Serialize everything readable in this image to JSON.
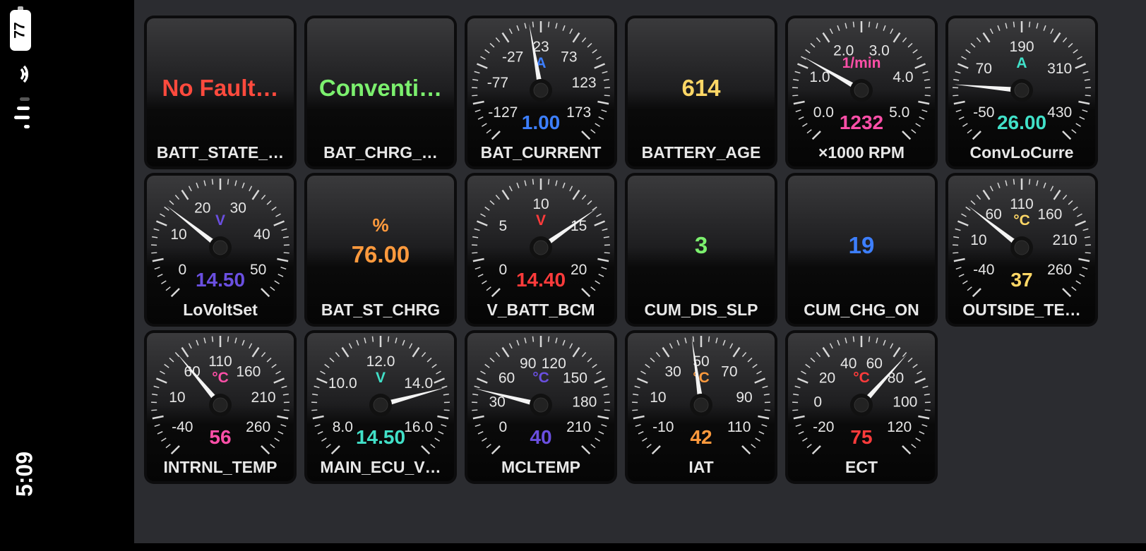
{
  "status_bar": {
    "time": "5:09",
    "battery": "77",
    "wifi_icon": "wifi-icon",
    "signal_icon": "cellular-signal-icon"
  },
  "tiles": [
    {
      "kind": "text",
      "value": "No Fault…",
      "label": "BATT_STATE_…",
      "color": "#ff4a3d"
    },
    {
      "kind": "text",
      "value": "Conventi…",
      "label": "BAT_CHRG_…",
      "color": "#7cf06e"
    },
    {
      "kind": "gauge",
      "unit": "A",
      "value": "1.00",
      "label": "BAT_CURRENT",
      "ticks": [
        "-127",
        "-77",
        "-27",
        "23",
        "73",
        "123",
        "173"
      ],
      "needle": -10,
      "color": "#3d7fff"
    },
    {
      "kind": "text",
      "value": "614",
      "label": "BATTERY_AGE",
      "color": "#ffd766"
    },
    {
      "kind": "gauge",
      "unit": "1/min",
      "value": "1232",
      "label": "×1000 RPM",
      "ticks": [
        "0.0",
        "1.0",
        "2.0",
        "3.0",
        "4.0",
        "5.0"
      ],
      "needle": -60,
      "color": "#ff4fa8"
    },
    {
      "kind": "gauge",
      "unit": "A",
      "value": "26.00",
      "label": "ConvLoCurre",
      "ticks": [
        "-50",
        "70",
        "190",
        "310",
        "430"
      ],
      "needle": -85,
      "color": "#41e0c8"
    },
    {
      "kind": "gauge",
      "unit": "V",
      "value": "14.50",
      "label": "LoVoltSet",
      "ticks": [
        "0",
        "10",
        "20",
        "30",
        "40",
        "50"
      ],
      "needle": -52,
      "color": "#6a4fe0"
    },
    {
      "kind": "text2",
      "unit": "%",
      "value": "76.00",
      "label": "BAT_ST_CHRG",
      "color": "#ff9a3d"
    },
    {
      "kind": "gauge",
      "unit": "V",
      "value": "14.40",
      "label": "V_BATT_BCM",
      "ticks": [
        "0",
        "5",
        "10",
        "15",
        "20"
      ],
      "needle": 55,
      "color": "#ff3b3b"
    },
    {
      "kind": "text",
      "value": "3",
      "label": "CUM_DIS_SLP",
      "color": "#7cf06e"
    },
    {
      "kind": "text",
      "value": "19",
      "label": "CUM_CHG_ON",
      "color": "#3d7fff"
    },
    {
      "kind": "gauge",
      "unit": "°C",
      "value": "37",
      "label": "OUTSIDE_TE…",
      "ticks": [
        "-40",
        "10",
        "60",
        "110",
        "160",
        "210",
        "260"
      ],
      "needle": -52,
      "color": "#ffd766"
    },
    {
      "kind": "gauge",
      "unit": "°C",
      "value": "56",
      "label": "INTRNL_TEMP",
      "ticks": [
        "-40",
        "10",
        "60",
        "110",
        "160",
        "210",
        "260"
      ],
      "needle": -40,
      "color": "#ff4fa8"
    },
    {
      "kind": "gauge",
      "unit": "V",
      "value": "14.50",
      "label": "MAIN_ECU_V…",
      "ticks": [
        "8.0",
        "10.0",
        "12.0",
        "14.0",
        "16.0"
      ],
      "needle": 75,
      "color": "#41e0c8"
    },
    {
      "kind": "gauge",
      "unit": "°C",
      "value": "40",
      "label": "MCLTEMP",
      "ticks": [
        "0",
        "30",
        "60",
        "90",
        "120",
        "150",
        "180",
        "210"
      ],
      "needle": -76,
      "color": "#6a4fe0"
    },
    {
      "kind": "gauge",
      "unit": "°C",
      "value": "42",
      "label": "IAT",
      "ticks": [
        "-10",
        "10",
        "30",
        "50",
        "70",
        "90",
        "110"
      ],
      "needle": -8,
      "color": "#ff9a3d"
    },
    {
      "kind": "gauge",
      "unit": "°C",
      "value": "75",
      "label": "ECT",
      "ticks": [
        "-20",
        "0",
        "20",
        "40",
        "60",
        "80",
        "100",
        "120"
      ],
      "needle": 42,
      "color": "#ff3b3b"
    }
  ]
}
